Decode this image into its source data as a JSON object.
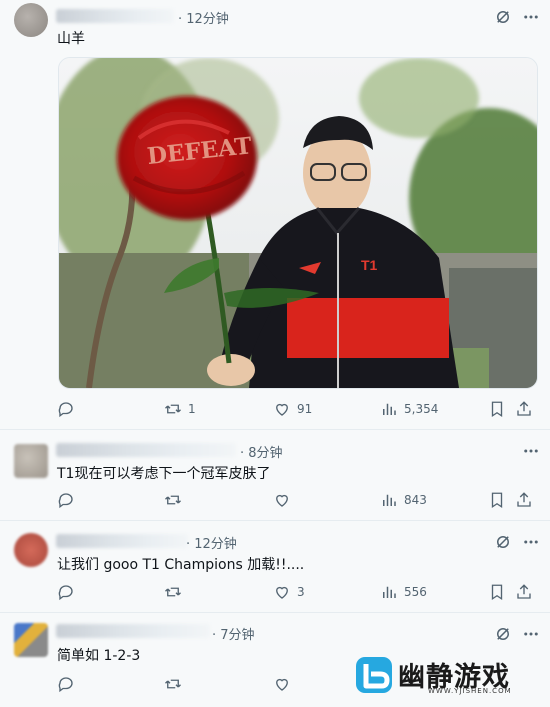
{
  "posts": [
    {
      "time": "· 12分钟",
      "text": "山羊",
      "image_text": "DEFEAT",
      "jersey_text": "T1",
      "actions": {
        "reply": "",
        "retweet": "1",
        "like": "91",
        "views": "5,354"
      }
    },
    {
      "time": "· 8分钟",
      "text": "T1现在可以考虑下一个冠军皮肤了",
      "actions": {
        "reply": "",
        "retweet": "",
        "like": "",
        "views": "843"
      }
    },
    {
      "time": "· 12分钟",
      "text": "让我们 gooo T1 Champions 加载!!....",
      "actions": {
        "reply": "",
        "retweet": "",
        "like": "3",
        "views": "556"
      }
    },
    {
      "time": "· 7分钟",
      "text": "简单如 1-2-3",
      "actions": {
        "reply": "",
        "retweet": "",
        "like": "",
        "views": ""
      }
    }
  ],
  "watermark": {
    "title": "幽静游戏",
    "url": "WWW.YJISHEN.COM"
  },
  "colors": {
    "text": "#0f1419",
    "muted": "#536471",
    "accent": "#1d9bf0"
  }
}
